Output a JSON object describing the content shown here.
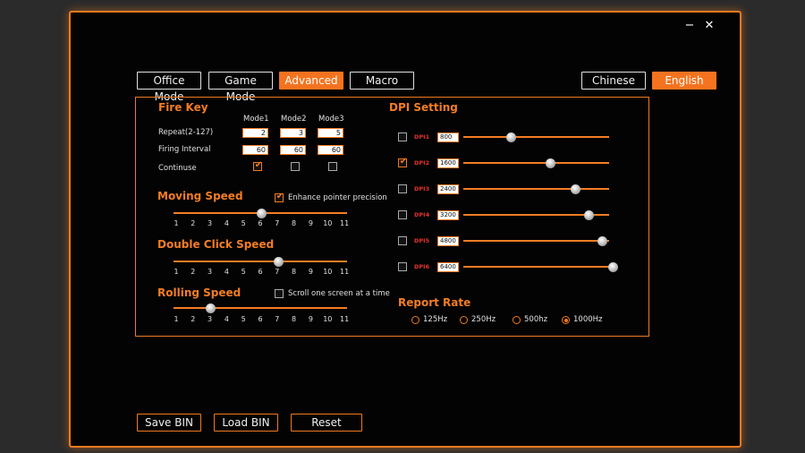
{
  "window": {
    "minimize_glyph": "−",
    "close_glyph": "✕"
  },
  "tabs": [
    {
      "label": "Office Mode",
      "active": false
    },
    {
      "label": "Game Mode",
      "active": false
    },
    {
      "label": "Advanced",
      "active": true
    },
    {
      "label": "Macro",
      "active": false
    }
  ],
  "languages": [
    {
      "label": "Chinese",
      "active": false
    },
    {
      "label": "English",
      "active": true
    }
  ],
  "fire_key": {
    "title": "Fire Key",
    "modes": [
      "Mode1",
      "Mode2",
      "Mode3"
    ],
    "rows": [
      {
        "label": "Repeat(2-127)",
        "values": [
          "2",
          "3",
          "5"
        ]
      },
      {
        "label": "Firing Interval",
        "values": [
          "60",
          "60",
          "60"
        ]
      }
    ],
    "continuse_label": "Continuse",
    "continuse": [
      true,
      false,
      false
    ]
  },
  "moving_speed": {
    "title": "Moving Speed",
    "option_label": "Enhance pointer precision",
    "option_checked": true,
    "ticks": [
      "1",
      "2",
      "3",
      "4",
      "5",
      "6",
      "7",
      "8",
      "9",
      "10",
      "11"
    ],
    "value": 6
  },
  "double_click_speed": {
    "title": "Double Click Speed",
    "ticks": [
      "1",
      "2",
      "3",
      "4",
      "5",
      "6",
      "7",
      "8",
      "9",
      "10",
      "11"
    ],
    "value": 7
  },
  "rolling_speed": {
    "title": "Rolling Speed",
    "option_label": "Scroll one screen at a time",
    "option_checked": false,
    "ticks": [
      "1",
      "2",
      "3",
      "4",
      "5",
      "6",
      "7",
      "8",
      "9",
      "10",
      "11"
    ],
    "value": 3
  },
  "dpi": {
    "title": "DPI Setting",
    "levels": [
      {
        "label": "DPI1",
        "value": "800",
        "checked": false,
        "slider": 0.31
      },
      {
        "label": "DPI2",
        "value": "1600",
        "checked": true,
        "slider": 0.58
      },
      {
        "label": "DPI3",
        "value": "2400",
        "checked": false,
        "slider": 0.75
      },
      {
        "label": "DPI4",
        "value": "3200",
        "checked": false,
        "slider": 0.84
      },
      {
        "label": "DPI5",
        "value": "4800",
        "checked": false,
        "slider": 0.93
      },
      {
        "label": "DPI6",
        "value": "6400",
        "checked": false,
        "slider": 1.0
      }
    ]
  },
  "report_rate": {
    "title": "Report Rate",
    "options": [
      "125Hz",
      "250Hz",
      "500hz",
      "1000Hz"
    ],
    "selected": "1000Hz"
  },
  "bottom_buttons": [
    "Save BIN",
    "Load BIN",
    "Reset"
  ],
  "colors": {
    "accent": "#f5731f",
    "dpi_label": "#e0322c"
  }
}
